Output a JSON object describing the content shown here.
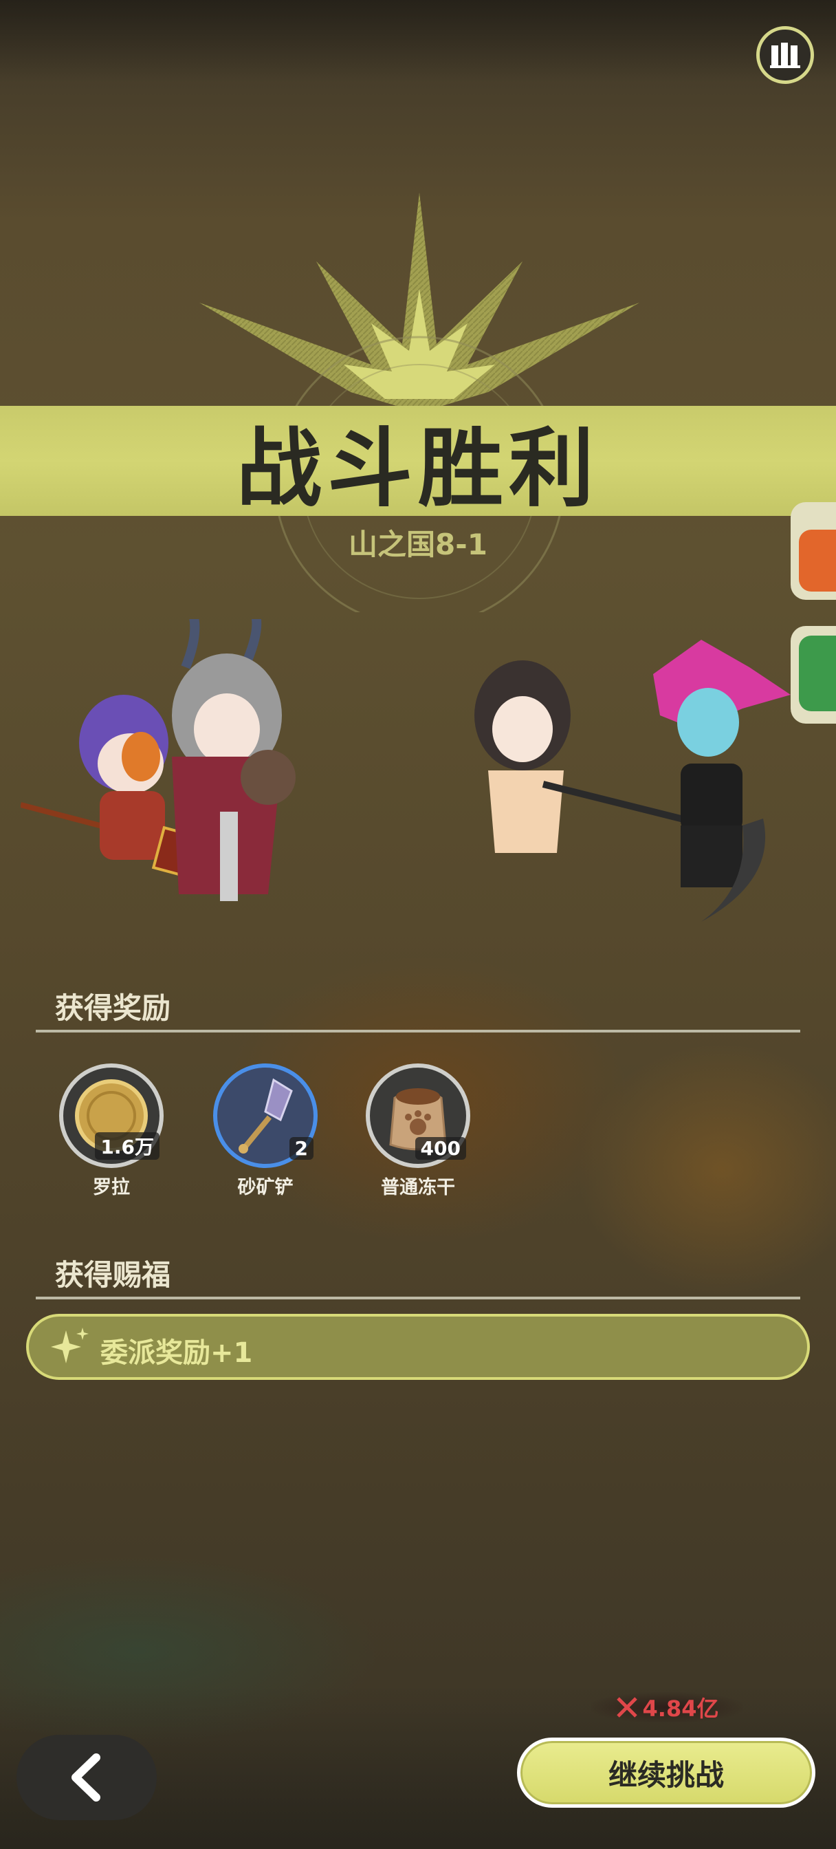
{
  "title": "战斗胜利",
  "stage": "山之国8-1",
  "rewards_section": {
    "title": "获得奖励",
    "items": [
      {
        "name": "罗拉",
        "qty": "1.6万",
        "icon": "gold-coin-icon"
      },
      {
        "name": "砂矿铲",
        "qty": "2",
        "icon": "shovel-icon"
      },
      {
        "name": "普通冻干",
        "qty": "400",
        "icon": "food-bag-icon"
      }
    ]
  },
  "blessing_section": {
    "title": "获得赐福",
    "item": "委派奖励+1"
  },
  "power": "4.84亿",
  "continue_label": "继续挑战",
  "colors": {
    "accent": "#d3d573",
    "power_red": "#e0474a",
    "dark_button": "#2e2d2a"
  }
}
